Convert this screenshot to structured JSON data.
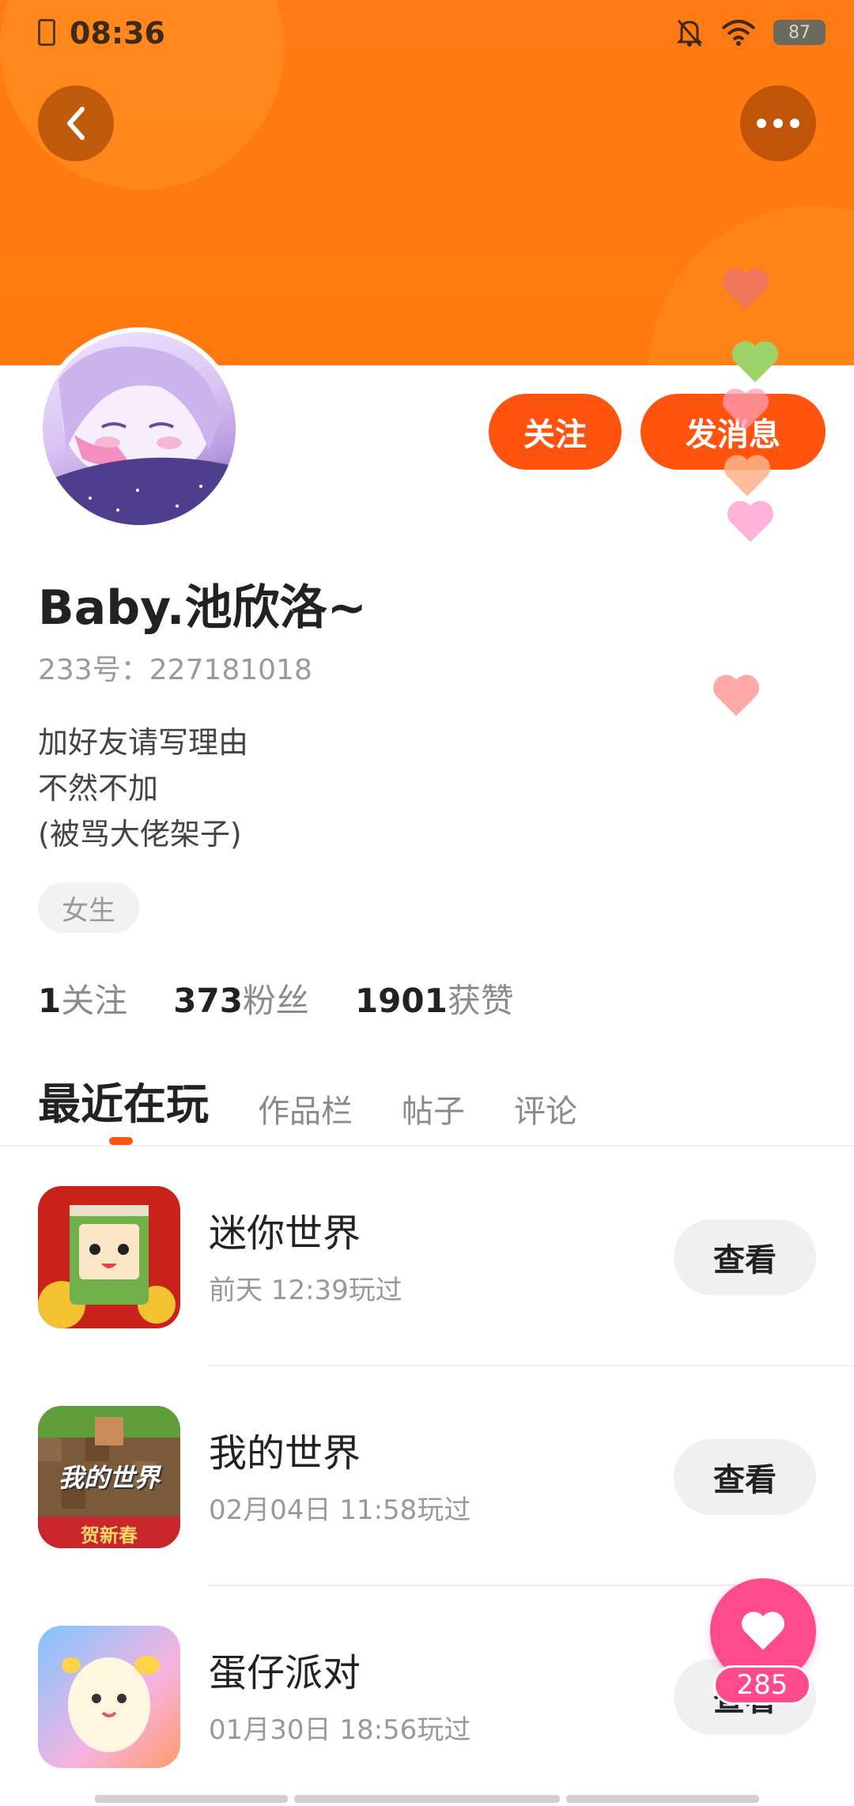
{
  "status_bar": {
    "time": "08:36",
    "battery": "87"
  },
  "actions": {
    "follow_label": "关注",
    "message_label": "发消息"
  },
  "profile": {
    "username": "Baby.池欣洛~",
    "uid": "233号：227181018",
    "bio": [
      "加好友请写理由",
      "不然不加",
      "(被骂大佬架子)"
    ],
    "tag": "女生"
  },
  "stats": [
    {
      "value": "1",
      "label": "关注"
    },
    {
      "value": "373",
      "label": "粉丝"
    },
    {
      "value": "1901",
      "label": "获赞"
    }
  ],
  "tabs": [
    "最近在玩",
    "作品栏",
    "帖子",
    "评论"
  ],
  "games": [
    {
      "name": "迷你世界",
      "played": "前天 12:39玩过",
      "button": "查看"
    },
    {
      "name": "我的世界",
      "played": "02月04日 11:58玩过",
      "button": "查看"
    },
    {
      "name": "蛋仔派对",
      "played": "01月30日 18:56玩过",
      "button": "查看"
    }
  ],
  "game_icon_text": {
    "minecraft_logo": "我的世界",
    "minecraft_banner": "贺新春"
  },
  "like": {
    "count": "285"
  },
  "colors": {
    "accent": "#ff5410",
    "header": "#ff7a12",
    "like": "#ff4b8c"
  }
}
